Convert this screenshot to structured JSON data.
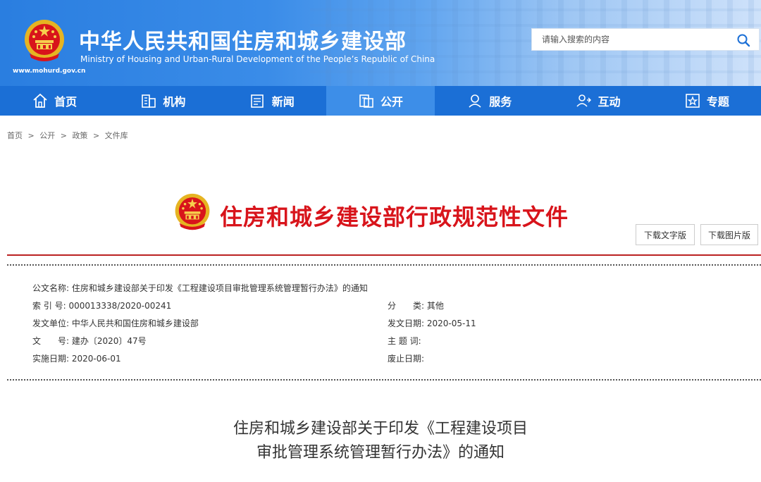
{
  "header": {
    "title": "中华人民共和国住房和城乡建设部",
    "subtitle": "Ministry of Housing and Urban-Rural Development of the People’s Republic of China",
    "url": "www.mohurd.gov.cn",
    "search_placeholder": "请输入搜索的内容"
  },
  "nav": {
    "items": [
      {
        "label": "首页",
        "icon": "home-icon"
      },
      {
        "label": "机构",
        "icon": "building-icon"
      },
      {
        "label": "新闻",
        "icon": "news-icon"
      },
      {
        "label": "公开",
        "icon": "document-icon"
      },
      {
        "label": "服务",
        "icon": "service-icon"
      },
      {
        "label": "互动",
        "icon": "interact-icon"
      },
      {
        "label": "专题",
        "icon": "star-icon"
      }
    ],
    "active": "公开"
  },
  "breadcrumb": [
    "首页",
    ">",
    "公开",
    ">",
    "政策",
    ">",
    "文件库"
  ],
  "banner": {
    "title": "住房和城乡建设部行政规范性文件",
    "download_text": "下载文字版",
    "download_image": "下载图片版"
  },
  "meta": {
    "doc_name_label": "公文名称:",
    "doc_name": "住房和城乡建设部关于印发《工程建设项目审批管理系统管理暂行办法》的通知",
    "index_label": "索 引 号:",
    "index": "000013338/2020-00241",
    "category_label": "分　　类:",
    "category": "其他",
    "issuer_label": "发文单位:",
    "issuer": "中华人民共和国住房和城乡建设部",
    "issue_date_label": "发文日期:",
    "issue_date": "2020-05-11",
    "doc_no_label": "文　　号:",
    "doc_no": "建办〔2020〕47号",
    "keywords_label": "主 题 词:",
    "keywords": "",
    "effective_label": "实施日期:",
    "effective": "2020-06-01",
    "repeal_label": "废止日期:",
    "repeal": ""
  },
  "doc_title": {
    "line1": "住房和城乡建设部关于印发《工程建设项目",
    "line2": "审批管理系统管理暂行办法》的通知"
  },
  "colors": {
    "nav_bg": "#1b6fd6",
    "nav_active": "#3d8ee8",
    "banner_red": "#d8141b"
  }
}
